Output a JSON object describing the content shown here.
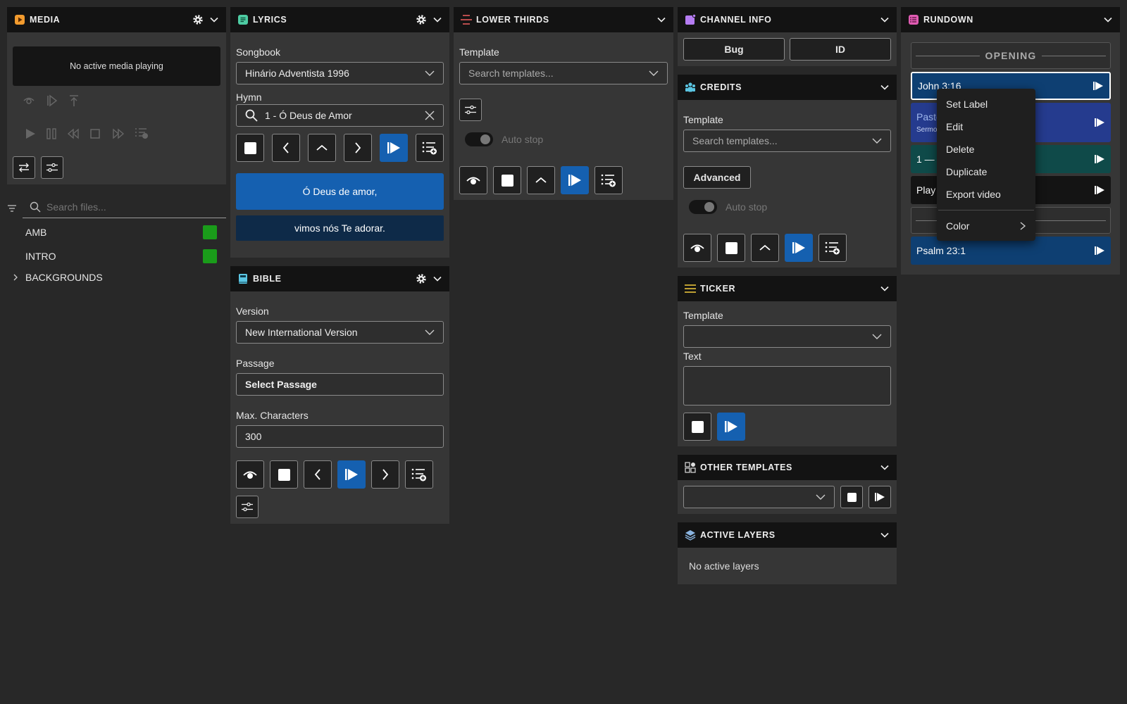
{
  "colors": {
    "accent_blue": "#1560b0",
    "media_icon": "#f29b2e",
    "lyrics_icon": "#4ecca3",
    "lower_thirds_icon": "#e35b5b",
    "channel_info_icon": "#b57cf2",
    "credits_icon": "#5bc6e3",
    "ticker_icon": "#e8c23a",
    "rundown_icon": "#e05cb3",
    "status_green": "#1a9c1a"
  },
  "media": {
    "title": "MEDIA",
    "status": "No active media playing",
    "search_placeholder": "Search files...",
    "files": [
      {
        "name": "AMB"
      },
      {
        "name": "INTRO"
      }
    ],
    "folder": "BACKGROUNDS"
  },
  "lyrics": {
    "title": "LYRICS",
    "songbook_label": "Songbook",
    "songbook_value": "Hinário Adventista 1996",
    "hymn_label": "Hymn",
    "hymn_value": "1 - Ó Deus de Amor",
    "line1": "Ó Deus de amor,",
    "line2": "vimos nós Te adorar."
  },
  "bible": {
    "title": "BIBLE",
    "version_label": "Version",
    "version_value": "New International Version",
    "passage_label": "Passage",
    "passage_button": "Select Passage",
    "maxchars_label": "Max. Characters",
    "maxchars_value": "300"
  },
  "lower_thirds": {
    "title": "LOWER THIRDS",
    "template_label": "Template",
    "template_placeholder": "Search templates...",
    "auto_stop": "Auto stop"
  },
  "channel_info": {
    "title": "CHANNEL INFO",
    "bug": "Bug",
    "id": "ID"
  },
  "credits": {
    "title": "CREDITS",
    "template_label": "Template",
    "template_placeholder": "Search templates...",
    "advanced": "Advanced",
    "auto_stop": "Auto stop"
  },
  "ticker": {
    "title": "TICKER",
    "template_label": "Template",
    "text_label": "Text"
  },
  "other_templates": {
    "title": "OTHER TEMPLATES"
  },
  "active_layers": {
    "title": "ACTIVE LAYERS",
    "empty": "No active layers"
  },
  "rundown": {
    "title": "RUNDOWN",
    "section": "OPENING",
    "items": [
      {
        "label": "John 3:16"
      },
      {
        "label": "Pasto",
        "sub": "Sermo"
      },
      {
        "label": "1 —"
      },
      {
        "label": "Play"
      },
      {
        "label": "Psalm 23:1"
      }
    ]
  },
  "context_menu": {
    "items": [
      "Set Label",
      "Edit",
      "Delete",
      "Duplicate",
      "Export video"
    ],
    "color": "Color"
  }
}
